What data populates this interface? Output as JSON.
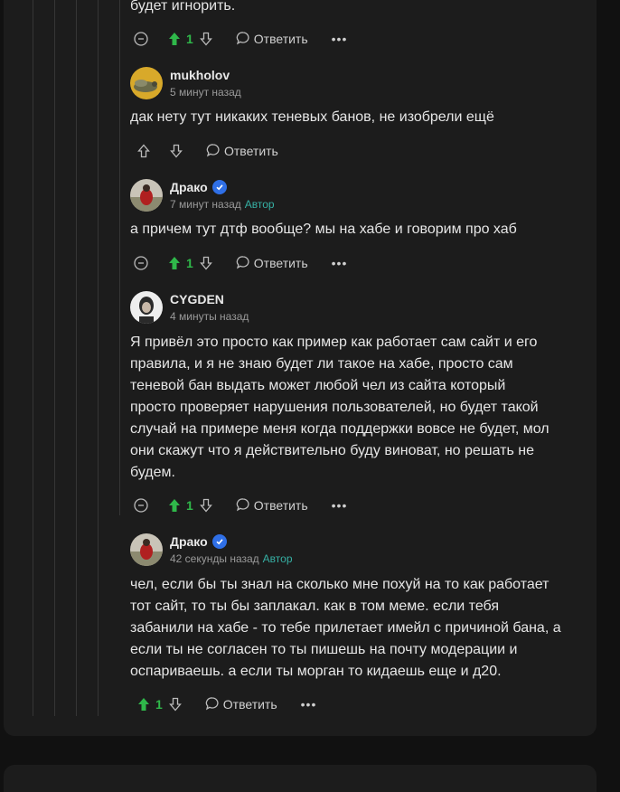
{
  "top_text": "будет игнорить.",
  "comments": [
    {
      "user": "mukholov",
      "time": "5 минут назад",
      "author_badge": "",
      "text": "дак нету тут никаких теневых банов, не изобрели ещё",
      "votes": "",
      "reply": "Ответить"
    },
    {
      "user": "Драко",
      "time": "7 минут назад",
      "author_badge": "Автор",
      "text": "а причем тут дтф вообще? мы на хабе и говорим про хаб",
      "votes": "1",
      "reply": "Ответить"
    },
    {
      "user": "CYGDEN",
      "time": "4 минуты назад",
      "author_badge": "",
      "text": "Я привёл это просто как пример как работает сам сайт и его правила, и я не знаю будет ли такое на хабе, просто сам теневой бан выдать может любой чел из сайта который просто проверяет нарушения пользователей, но будет такой случай на примере меня когда поддержки вовсе не будет, мол они скажут что я действительно буду виноват, но решать не будем.",
      "votes": "1",
      "reply": "Ответить"
    },
    {
      "user": "Драко",
      "time": "42 секунды назад",
      "author_badge": "Автор",
      "text": "чел, если бы ты знал на сколько мне похуй на то как работает тот сайт, то ты бы заплакал. как в том меме. если тебя забанили на хабе - то тебе прилетает имейл с причиной бана, а если ты не согласен то ты пишешь на почту модерации и оспариваешь. а если ты морган то кидаешь еще и д20.",
      "votes": "1",
      "reply": "Ответить"
    }
  ],
  "top_actions": {
    "votes": "1",
    "reply": "Ответить"
  },
  "more_label": "•••",
  "colors": {
    "accent_green": "#2fb84a",
    "author": "#36b0a4",
    "verified": "#2f6fe6"
  },
  "icons": [
    "collapse-icon",
    "arrow-up-icon",
    "arrow-down-icon",
    "reply-bubble-icon",
    "more-icon",
    "verified-icon"
  ]
}
